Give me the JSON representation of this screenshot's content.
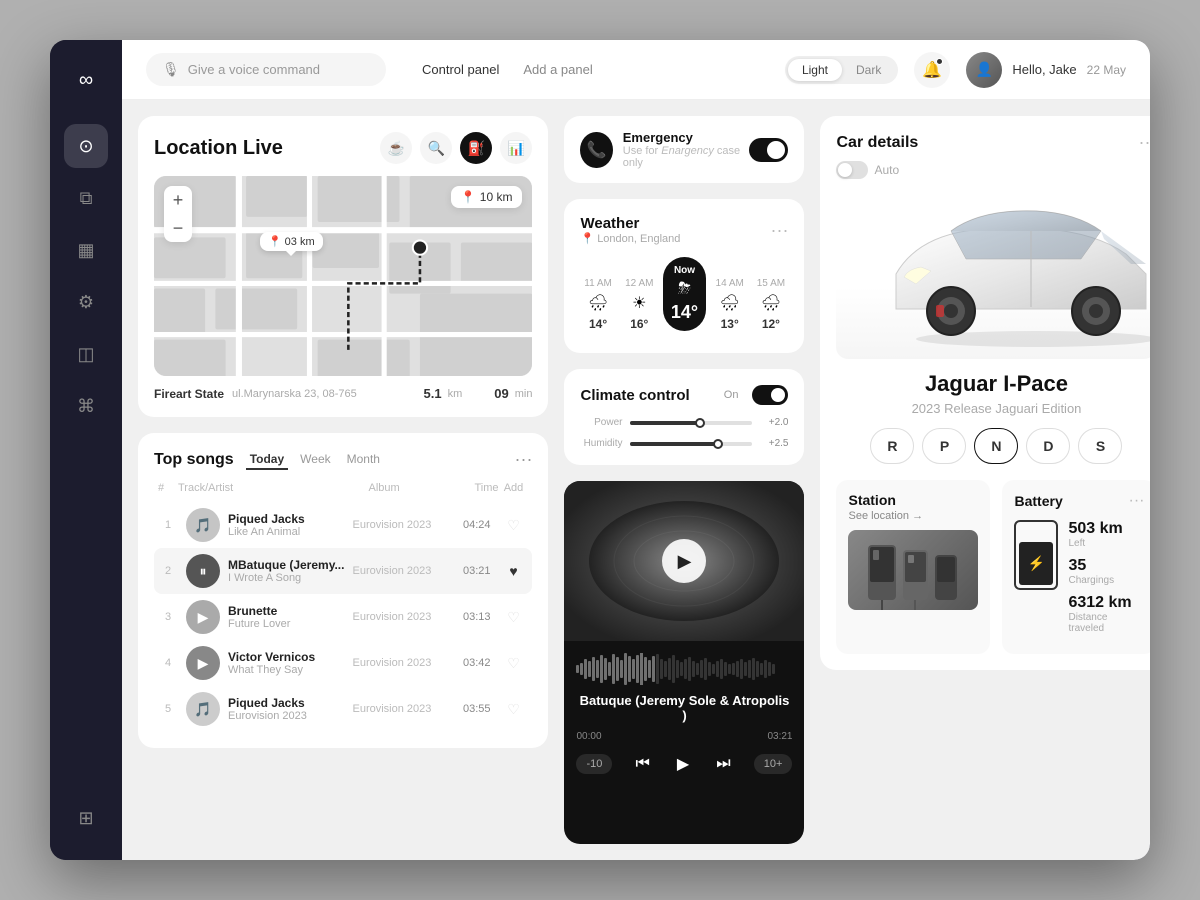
{
  "sidebar": {
    "logo": "∞",
    "items": [
      {
        "id": "dashboard",
        "icon": "⊙",
        "active": true
      },
      {
        "id": "sliders",
        "icon": "⧉"
      },
      {
        "id": "calendar",
        "icon": "▦"
      },
      {
        "id": "settings",
        "icon": "⚙"
      },
      {
        "id": "map",
        "icon": "◫"
      },
      {
        "id": "bluetooth",
        "icon": "⌘"
      },
      {
        "id": "save",
        "icon": "⊞",
        "bottom": true
      }
    ]
  },
  "topbar": {
    "voice_placeholder": "Give a voice command",
    "nav": [
      "Control panel",
      "Add a panel"
    ],
    "active_nav": "Control panel",
    "theme_light": "Light",
    "theme_dark": "Dark",
    "user_name": "Hello, Jake",
    "user_date": "22 May"
  },
  "location": {
    "title": "Location Live",
    "distance_badge": "10 km",
    "pin1_label": "03 km",
    "pin2_label": "10 km",
    "place_name": "Fireart State",
    "address": "ul.Marynarska 23, 08-765",
    "dist_num": "5.1",
    "dist_unit": "km",
    "eta": "09",
    "eta_unit": "min"
  },
  "topsongs": {
    "title": "Top songs",
    "tabs": [
      "Today",
      "Week",
      "Month"
    ],
    "active_tab": "Today",
    "cols": [
      "#",
      "Track/Artist",
      "Album",
      "Time",
      "Add"
    ],
    "songs": [
      {
        "num": 1,
        "name": "Piqued Jacks",
        "artist": "Like An Animal",
        "album": "Eurovision 2023",
        "time": "04:24",
        "liked": false,
        "icon": "🎵"
      },
      {
        "num": 2,
        "name": "MBatuque (Jeremy...",
        "artist": "I Wrote A Song",
        "album": "Eurovision 2023",
        "time": "03:21",
        "liked": true,
        "icon": "⏸"
      },
      {
        "num": 3,
        "name": "Brunette",
        "artist": "Future Lover",
        "album": "Eurovision 2023",
        "time": "03:13",
        "liked": false,
        "icon": "▶"
      },
      {
        "num": 4,
        "name": "Victor Vernicos",
        "artist": "What They Say",
        "album": "Eurovision 2023",
        "time": "03:42",
        "liked": false,
        "icon": "▶"
      },
      {
        "num": 5,
        "name": "Piqued Jacks",
        "artist": "Eurovision 2023",
        "album": "Eurovision 2023",
        "time": "03:55",
        "liked": false,
        "icon": "🎵"
      }
    ]
  },
  "emergency": {
    "title": "Emergency",
    "subtitle": "Use for Enargency case only",
    "italic_word": "Enargency",
    "toggle_on": true
  },
  "weather": {
    "title": "Weather",
    "location": "London, England",
    "slots": [
      {
        "time": "11 AM",
        "icon": "🌧",
        "temp": "14°"
      },
      {
        "time": "12 AM",
        "icon": "☀",
        "temp": "16°"
      },
      {
        "time": "Now",
        "icon": "🌩",
        "temp": "14°",
        "current": true
      },
      {
        "time": "14 AM",
        "icon": "🌧",
        "temp": "13°"
      },
      {
        "time": "15 AM",
        "icon": "🌧",
        "temp": "12°"
      }
    ]
  },
  "climate": {
    "title": "Climate control",
    "status": "On",
    "controls": [
      {
        "label": "Power",
        "value": 60,
        "display": "+2.0"
      },
      {
        "label": "Humidity",
        "value": 75,
        "display": "+2.5"
      }
    ]
  },
  "player": {
    "title": "Batuque (Jeremy Sole & Atropolis )",
    "time_current": "00:00",
    "time_total": "03:21",
    "rewind": "-10",
    "forward": "10+"
  },
  "car": {
    "title": "Car details",
    "auto_label": "Auto",
    "name": "Jaguar I-Pace",
    "edition": "2023 Release Jaguari Edition",
    "gears": [
      "R",
      "P",
      "N",
      "D",
      "S"
    ],
    "active_gear": "N",
    "station_title": "Station",
    "station_link": "See location →",
    "battery_title": "Battery",
    "battery_km": "503 km",
    "battery_km_label": "Left",
    "battery_chargings": "35",
    "battery_chargings_label": "Chargings",
    "battery_distance": "6312 km",
    "battery_distance_label": "Distance traveled"
  }
}
